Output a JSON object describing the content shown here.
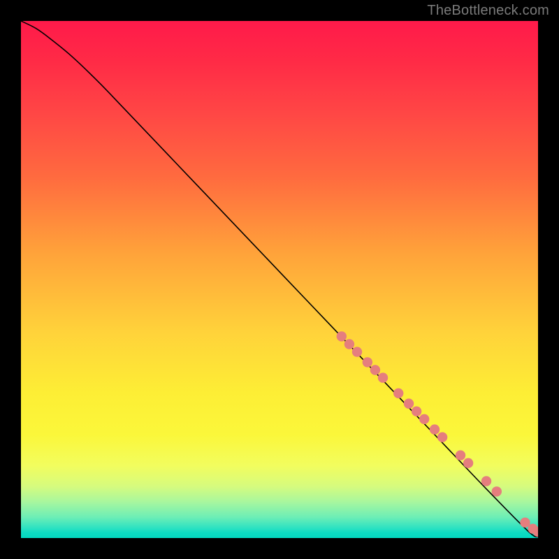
{
  "watermark": "TheBottleneck.com",
  "colors": {
    "curve": "#000000",
    "dot_fill": "#e57e7e",
    "dot_stroke": "#c26767"
  },
  "chart_data": {
    "type": "line",
    "title": "",
    "xlabel": "",
    "ylabel": "",
    "xlim": [
      0,
      100
    ],
    "ylim": [
      0,
      100
    ],
    "grid": false,
    "curve": {
      "x": [
        0,
        3,
        6,
        10,
        15,
        20,
        30,
        40,
        50,
        60,
        70,
        80,
        90,
        98,
        100
      ],
      "y": [
        100,
        98.5,
        96.3,
        93.0,
        88.2,
        83.0,
        72.5,
        62.0,
        51.5,
        41.0,
        30.5,
        20.0,
        9.5,
        1.4,
        0.2
      ]
    },
    "dots": {
      "r": 7.2,
      "points": [
        {
          "x": 62.0,
          "y": 39.0
        },
        {
          "x": 63.5,
          "y": 37.5
        },
        {
          "x": 65.0,
          "y": 36.0
        },
        {
          "x": 67.0,
          "y": 34.0
        },
        {
          "x": 68.5,
          "y": 32.5
        },
        {
          "x": 70.0,
          "y": 31.0
        },
        {
          "x": 73.0,
          "y": 28.0
        },
        {
          "x": 75.0,
          "y": 26.0
        },
        {
          "x": 76.5,
          "y": 24.5
        },
        {
          "x": 78.0,
          "y": 23.0
        },
        {
          "x": 80.0,
          "y": 21.0
        },
        {
          "x": 81.5,
          "y": 19.5
        },
        {
          "x": 85.0,
          "y": 16.0
        },
        {
          "x": 86.5,
          "y": 14.5
        },
        {
          "x": 90.0,
          "y": 11.0
        },
        {
          "x": 92.0,
          "y": 9.0
        },
        {
          "x": 97.5,
          "y": 3.0
        },
        {
          "x": 99.0,
          "y": 1.8
        },
        {
          "x": 100.0,
          "y": 1.2
        }
      ]
    }
  }
}
